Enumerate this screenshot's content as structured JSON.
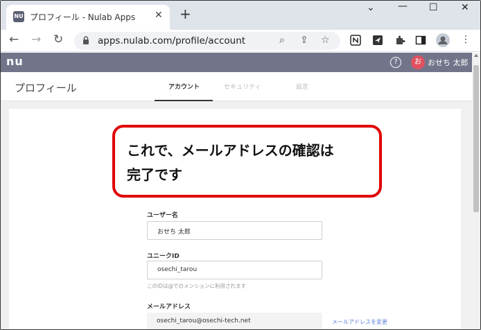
{
  "browser": {
    "tab_title": "プロフィール - Nulab Apps",
    "tab_favicon_text": "NU",
    "url": "apps.nulab.com/profile/account",
    "icons": [
      "back-icon",
      "forward-icon",
      "reload-icon",
      "lock-icon",
      "zoom-icon",
      "share-icon",
      "star-icon",
      "notion-icon",
      "send-icon",
      "puzzle-icon",
      "sidepanel-icon",
      "profile-icon",
      "menu-icon"
    ]
  },
  "app": {
    "logo": "nu",
    "avatar_initial": "お",
    "user_name": "おせち 太郎"
  },
  "page": {
    "title": "プロフィール",
    "tabs": [
      {
        "label": "アカウント",
        "active": true
      },
      {
        "label": "セキュリティ",
        "active": false
      },
      {
        "label": "設定",
        "active": false
      }
    ]
  },
  "form": {
    "username_label": "ユーザー名",
    "username_value": "おせち 太郎",
    "unique_id_label": "ユニークID",
    "unique_id_value": "osechi_tarou",
    "unique_id_hint": "このIDは@でのメンションに利用されます",
    "email_label": "メールアドレス",
    "email_value": "osechi_tarou@osechi-tech.net",
    "email_change_link": "メールアドレスを変更"
  },
  "callout": {
    "line1": "これで、メールアドレスの確認は",
    "line2": "完了です"
  },
  "colors": {
    "app_header": "#72758a",
    "avatar_bg": "#e05260",
    "callout_border": "#e00000",
    "link": "#5a7fd6"
  }
}
